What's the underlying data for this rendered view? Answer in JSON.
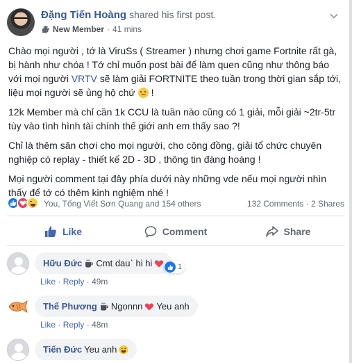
{
  "post": {
    "author": "Đặng Tiến Hoàng",
    "action_text": "shared his first post.",
    "badge": "New Member",
    "separator": "·",
    "time": "41 mins",
    "paragraphs": [
      {
        "before": "Chào mọi người , tớ là ViruSs ( Streamer ) nhưng chơi game Fortnite rất gà, bị hành như chóa ! Tớ chỉ muốn post bài để làm quen cũng như thông báo với mọi người ",
        "link": "VRTV",
        "after": " sẽ làm giải FORTNITE theo tuần trong thời gian sắp tới, liệu mọi người sẽ ủng hộ chứ ",
        "tail": " !"
      },
      {
        "text": "12k Member mà chỉ cần 1k CCU là tuần nào cũng có 1 giải, mỗi giải ~2tr-5tr tùy vào tình hình tài chính thế giới anh em thấy sao ?!"
      },
      {
        "text": "Chỉ là thêm sân chơi cho mọi người, cho cộng đồng, giải tổ chức chuyên nghiệp có replay - thiết kế 2D - 3D , thông tin đàng hoàng !"
      },
      {
        "text": "Mọi người comment tại đây phía dưới này những vde nếu mọi người nhìn thấy để tớ có thêm kinh nghiệm nhé !"
      }
    ],
    "reactions": {
      "names": "You, Tống Viết Sơn Quang and 154 others",
      "comments": "132 Comments",
      "shares": "2 Shares",
      "dot": "·"
    },
    "actions": {
      "like": "Like",
      "comment": "Comment",
      "share": "Share"
    }
  },
  "comments": [
    {
      "name": "Hữu Đức",
      "text": "Cmt dau` hi hi",
      "like": "Like",
      "reply": "Reply",
      "time": "49m",
      "dot": "·",
      "reaction_count": "1"
    },
    {
      "name": "Thế Phương",
      "text": "Ngonnn",
      "text2": "Yeu anh",
      "like": "Like",
      "reply": "Reply",
      "time": "48m",
      "dot": "·"
    },
    {
      "name": "Tiến Đức",
      "text": "Yeu anh"
    }
  ],
  "cutoff_text": "· ··  · ·",
  "colors": {
    "link": "#365899",
    "like_blue": "#4267b2",
    "love_red": "#f33e58",
    "bubble": "#f2f3f5"
  }
}
